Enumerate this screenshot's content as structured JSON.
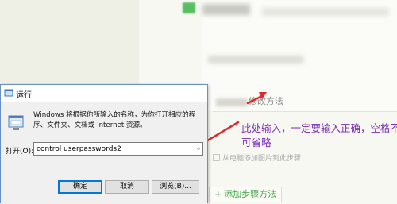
{
  "background_page": {
    "step_title": "修改方法",
    "note": "此处输入，一定要输入正确，空格不可省略",
    "checkbox_label": "从电脑添加图片到此步骤",
    "add_step_label": "添加步骤方法",
    "colors": {
      "note": "#7d2bb5",
      "accent_green": "#45a845",
      "arrow": "#e0292b"
    }
  },
  "run_dialog": {
    "title": "运行",
    "description": "Windows 将根据你所输入的名称，为你打开相应的程序、文件夹、文档或 Internet 资源。",
    "open_label": "打开(O):",
    "open_value": "control userpasswords2",
    "buttons": {
      "ok": "确定",
      "cancel": "取消",
      "browse": "浏览(B)..."
    },
    "icons": {
      "title": "run-app-icon",
      "body": "run-program-icon",
      "dropdown": "chevron-down-icon"
    }
  }
}
